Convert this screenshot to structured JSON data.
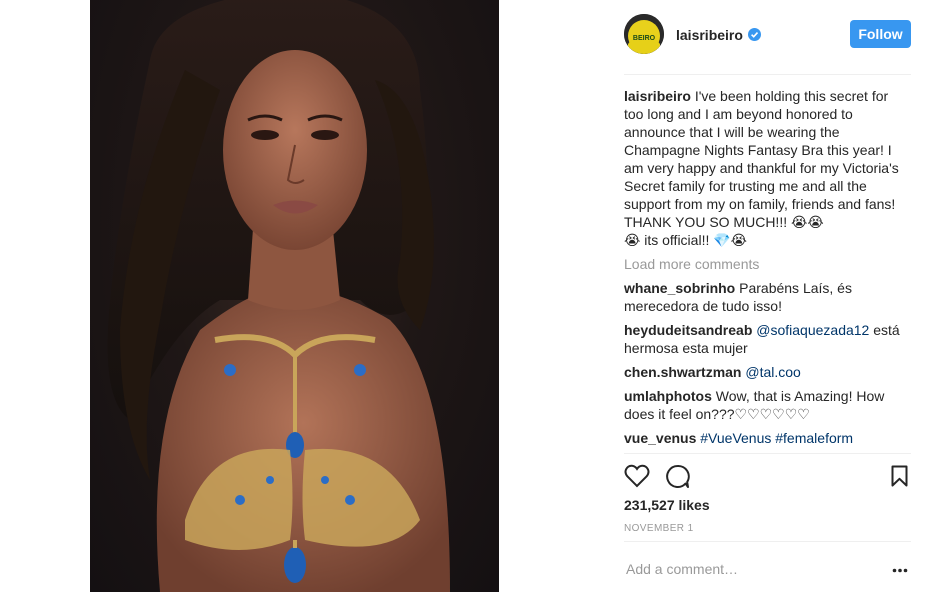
{
  "post": {
    "username": "laisribeiro",
    "follow_label": "Follow",
    "avatar_text": "BEIRO",
    "caption_user": "laisribeiro",
    "caption_text": "I've been holding this secret for too long and I am beyond honored to announce that I will be wearing the Champagne Nights Fantasy Bra this year! I am very happy and thankful for my Victoria's Secret family for trusting me and all the support from my on family, friends and fans! THANK YOU SO MUCH!!! 😭😭",
    "caption_text_2": "😭 its official!! 💎😭",
    "load_more": "Load more comments",
    "comments": [
      {
        "user": "whane_sobrinho",
        "text": "Parabéns Laís, és merecedora de tudo isso!"
      },
      {
        "user": "heydudeitsandreab",
        "mention": "@sofiaquezada12",
        "text": "está hermosa esta mujer"
      },
      {
        "user": "chen.shwartzman",
        "mention": "@tal.coo",
        "text": ""
      },
      {
        "user": "umlahphotos",
        "text": "Wow, that is Amazing! How does it feel on???♡♡♡♡♡♡"
      },
      {
        "user": "vue_venus",
        "mention": "#VueVenus #femaleform",
        "text": ""
      }
    ],
    "likes": "231,527 likes",
    "date": "NOVEMBER 1",
    "add_comment_placeholder": "Add a comment…",
    "colors": {
      "accent": "#3897f0",
      "mention": "#003569",
      "muted": "#999999"
    }
  }
}
